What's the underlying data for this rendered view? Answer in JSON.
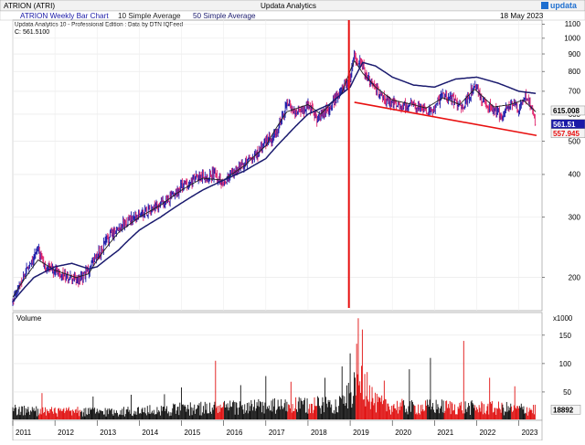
{
  "header": {
    "symbol": "ATRION (ATRI)",
    "provider": "Updata Analytics",
    "brand": "updata",
    "date": "18 May 2023"
  },
  "legend": {
    "chart_name": "ATRION Weekly Bar Chart",
    "ma10_label": "10 Simple Average",
    "ma50_label": "50 Simple Average",
    "edition": "Updata Analytics 10 - Professional Edition : Data by DTN IQFeed",
    "close_readout": "C: 561.5100"
  },
  "colors": {
    "up_bar": "#1a1aa8",
    "down_bar": "#e0206a",
    "ma10": "#202020",
    "ma50": "#1a1a6e",
    "trendline": "#e81010",
    "marker": "#e81010",
    "vol_up": "#111111",
    "vol_down": "#e01010",
    "label_last": "#1a1aa8",
    "label_ma": "#e81010",
    "label_neutral": "#f4f4f4"
  },
  "chart_data": [
    {
      "type": "bar",
      "title": "ATRION Weekly Bar Chart",
      "scale": "log",
      "ylim": [
        160,
        1130
      ],
      "y_ticks": [
        200,
        300,
        400,
        500,
        600,
        700,
        800,
        900,
        1000,
        1100
      ],
      "x_ticks": [
        "2011",
        "2012",
        "2013",
        "2014",
        "2015",
        "2016",
        "2017",
        "2018",
        "2019",
        "2020",
        "2021",
        "2022",
        "2023"
      ],
      "xlim": [
        2011.0,
        2023.55
      ],
      "price_labels": [
        "615.008",
        "561.51",
        "557.945"
      ],
      "price_anchors": [
        [
          2011.0,
          170
        ],
        [
          2011.35,
          215
        ],
        [
          2011.6,
          240
        ],
        [
          2011.75,
          215
        ],
        [
          2012.0,
          212
        ],
        [
          2012.3,
          200
        ],
        [
          2012.6,
          195
        ],
        [
          2012.8,
          210
        ],
        [
          2013.0,
          230
        ],
        [
          2013.3,
          265
        ],
        [
          2013.6,
          285
        ],
        [
          2014.0,
          305
        ],
        [
          2014.4,
          320
        ],
        [
          2014.8,
          345
        ],
        [
          2015.0,
          370
        ],
        [
          2015.4,
          395
        ],
        [
          2015.8,
          400
        ],
        [
          2016.0,
          380
        ],
        [
          2016.4,
          425
        ],
        [
          2016.8,
          460
        ],
        [
          2017.0,
          500
        ],
        [
          2017.2,
          510
        ],
        [
          2017.5,
          640
        ],
        [
          2017.7,
          610
        ],
        [
          2017.9,
          620
        ],
        [
          2018.0,
          650
        ],
        [
          2018.2,
          580
        ],
        [
          2018.5,
          630
        ],
        [
          2018.8,
          700
        ],
        [
          2019.0,
          760
        ],
        [
          2019.1,
          880
        ],
        [
          2019.25,
          850
        ],
        [
          2019.4,
          760
        ],
        [
          2019.6,
          710
        ],
        [
          2019.8,
          660
        ],
        [
          2020.0,
          650
        ],
        [
          2020.25,
          630
        ],
        [
          2020.5,
          640
        ],
        [
          2020.8,
          610
        ],
        [
          2021.0,
          620
        ],
        [
          2021.2,
          690
        ],
        [
          2021.5,
          650
        ],
        [
          2021.7,
          630
        ],
        [
          2021.95,
          730
        ],
        [
          2022.2,
          640
        ],
        [
          2022.4,
          620
        ],
        [
          2022.6,
          600
        ],
        [
          2022.8,
          650
        ],
        [
          2023.0,
          620
        ],
        [
          2023.15,
          680
        ],
        [
          2023.3,
          640
        ],
        [
          2023.4,
          561.51
        ]
      ],
      "ma10_anchors": [
        [
          2011.0,
          175
        ],
        [
          2011.6,
          225
        ],
        [
          2012.0,
          210
        ],
        [
          2012.5,
          200
        ],
        [
          2012.8,
          205
        ],
        [
          2013.0,
          225
        ],
        [
          2013.5,
          270
        ],
        [
          2014.0,
          300
        ],
        [
          2014.5,
          325
        ],
        [
          2015.0,
          360
        ],
        [
          2015.5,
          390
        ],
        [
          2016.0,
          385
        ],
        [
          2016.5,
          425
        ],
        [
          2017.0,
          485
        ],
        [
          2017.5,
          610
        ],
        [
          2018.0,
          640
        ],
        [
          2018.3,
          600
        ],
        [
          2018.8,
          690
        ],
        [
          2019.1,
          860
        ],
        [
          2019.3,
          790
        ],
        [
          2019.6,
          720
        ],
        [
          2020.0,
          660
        ],
        [
          2020.5,
          640
        ],
        [
          2020.8,
          625
        ],
        [
          2021.2,
          670
        ],
        [
          2021.6,
          640
        ],
        [
          2021.95,
          710
        ],
        [
          2022.4,
          630
        ],
        [
          2022.8,
          640
        ],
        [
          2023.1,
          660
        ],
        [
          2023.4,
          610
        ]
      ],
      "ma50_anchors": [
        [
          2011.0,
          170
        ],
        [
          2011.5,
          200
        ],
        [
          2012.0,
          215
        ],
        [
          2012.4,
          220
        ],
        [
          2012.8,
          212
        ],
        [
          2013.0,
          215
        ],
        [
          2013.5,
          240
        ],
        [
          2014.0,
          275
        ],
        [
          2014.5,
          300
        ],
        [
          2015.0,
          330
        ],
        [
          2015.5,
          360
        ],
        [
          2016.0,
          385
        ],
        [
          2016.5,
          410
        ],
        [
          2017.0,
          445
        ],
        [
          2017.5,
          520
        ],
        [
          2018.0,
          600
        ],
        [
          2018.5,
          640
        ],
        [
          2019.0,
          720
        ],
        [
          2019.3,
          850
        ],
        [
          2019.6,
          830
        ],
        [
          2020.0,
          770
        ],
        [
          2020.5,
          730
        ],
        [
          2021.0,
          720
        ],
        [
          2021.5,
          760
        ],
        [
          2022.0,
          770
        ],
        [
          2022.5,
          740
        ],
        [
          2023.0,
          700
        ],
        [
          2023.4,
          690
        ]
      ],
      "trendline": [
        [
          2019.1,
          650
        ],
        [
          2023.42,
          520
        ]
      ],
      "event_marker_x": 2018.97
    },
    {
      "type": "bar",
      "title": "Volume",
      "unit_label": "x1000",
      "ylim": [
        0,
        190
      ],
      "y_ticks": [
        50,
        100,
        150
      ],
      "last_value_label": "18892",
      "last_value": 18.892,
      "volume_anchors": [
        [
          2011.0,
          18
        ],
        [
          2012.0,
          15
        ],
        [
          2013.0,
          15
        ],
        [
          2014.0,
          16
        ],
        [
          2015.0,
          20
        ],
        [
          2016.0,
          22
        ],
        [
          2017.0,
          24
        ],
        [
          2018.0,
          26
        ],
        [
          2018.8,
          30
        ],
        [
          2019.0,
          45
        ],
        [
          2019.3,
          70
        ],
        [
          2019.6,
          30
        ],
        [
          2020.0,
          25
        ],
        [
          2020.5,
          22
        ],
        [
          2021.0,
          24
        ],
        [
          2022.0,
          22
        ],
        [
          2023.0,
          20
        ],
        [
          2023.4,
          19
        ]
      ],
      "volume_spikes": [
        [
          2011.7,
          48
        ],
        [
          2012.9,
          42
        ],
        [
          2013.8,
          45
        ],
        [
          2014.6,
          46
        ],
        [
          2015.0,
          58
        ],
        [
          2015.8,
          105
        ],
        [
          2016.4,
          62
        ],
        [
          2017.0,
          78
        ],
        [
          2017.6,
          68
        ],
        [
          2018.4,
          75
        ],
        [
          2018.8,
          95
        ],
        [
          2019.0,
          118
        ],
        [
          2019.15,
          135
        ],
        [
          2019.2,
          180
        ],
        [
          2019.28,
          160
        ],
        [
          2019.4,
          85
        ],
        [
          2019.8,
          70
        ],
        [
          2020.4,
          90
        ],
        [
          2020.9,
          110
        ],
        [
          2021.7,
          140
        ],
        [
          2022.3,
          75
        ],
        [
          2022.9,
          60
        ]
      ]
    }
  ]
}
